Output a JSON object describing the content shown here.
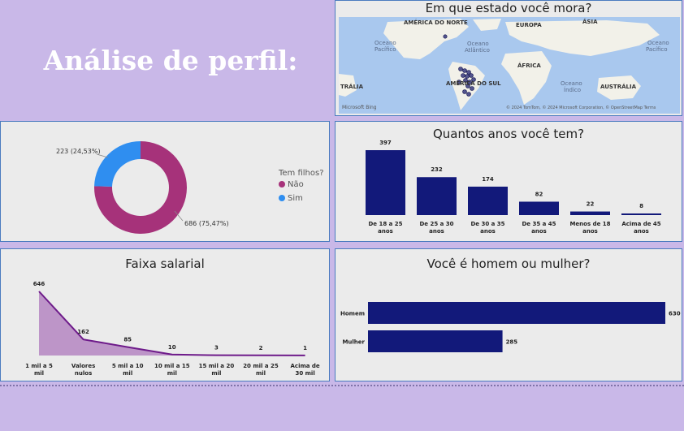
{
  "page": {
    "title": "Análise de perfil:"
  },
  "map_panel": {
    "title": "Em que estado você mora?",
    "labels": {
      "north_america": "AMÉRICA DO NORTE",
      "europe": "EUROPA",
      "asia": "ÁSIA",
      "pacific_left": "Oceano\nPacífico",
      "atlantic": "Oceano\nAtlântico",
      "pacific_right": "Oceano\nPacífico",
      "africa": "ÁFRICA",
      "south_america": "AMÉRICA DO SUL",
      "indian": "Oceano\nÍndico",
      "australia_left": "TRÁLIA",
      "australia": "AUSTRÁLIA"
    },
    "logo_text": "Microsoft Bing",
    "copyright": "© 2024 TomTom, © 2024 Microsoft Corporation, © OpenStreetMap  Terms"
  },
  "charts": {
    "donut": {
      "type": "pie",
      "legend_title": "Tem filhos?",
      "categories": [
        "Não",
        "Sim"
      ],
      "values": [
        686,
        223
      ],
      "data_labels": [
        "686 (75,47%)",
        "223 (24,53%)"
      ],
      "colors": [
        "#a6327a",
        "#2f8ef0"
      ]
    },
    "age": {
      "type": "bar",
      "title": "Quantos anos você tem?",
      "categories": [
        [
          "De 18 a 25",
          "anos"
        ],
        [
          "De 25 a 30",
          "anos"
        ],
        [
          "De 30 a 35",
          "anos"
        ],
        [
          "De 35 a 45",
          "anos"
        ],
        [
          "Menos de 18",
          "anos"
        ],
        [
          "Acima de 45",
          "anos"
        ]
      ],
      "values": [
        397,
        232,
        174,
        82,
        22,
        8
      ],
      "color": "#12197a"
    },
    "salary": {
      "type": "area",
      "title": "Faixa salarial",
      "categories": [
        [
          "1 mil a 5",
          "mil"
        ],
        [
          "Valores",
          "nulos"
        ],
        [
          "5 mil a 10",
          "mil"
        ],
        [
          "10 mil a 15",
          "mil"
        ],
        [
          "15 mil a 20",
          "mil"
        ],
        [
          "20 mil a 25",
          "mil"
        ],
        [
          "Acima de",
          "30 mil"
        ]
      ],
      "values": [
        646,
        162,
        85,
        10,
        3,
        2,
        1
      ],
      "line_color": "#6e1b8a",
      "fill_color": "#b17fbf"
    },
    "gender": {
      "type": "bar",
      "title": "Você é homem ou mulher?",
      "categories": [
        "Homem",
        "Mulher"
      ],
      "values": [
        630,
        285
      ],
      "color": "#12197a"
    }
  }
}
